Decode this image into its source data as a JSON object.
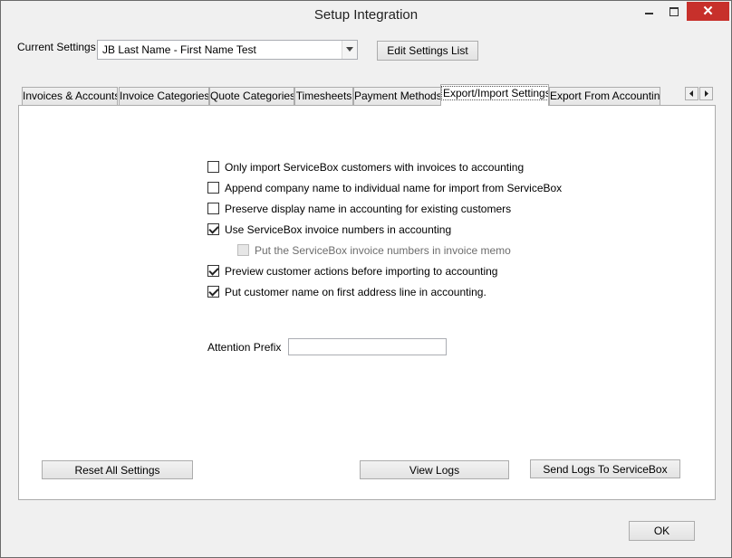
{
  "window": {
    "title": "Setup Integration",
    "close_glyph": "✕"
  },
  "settings": {
    "label": "Current Settings",
    "selected": "JB Last Name - First Name Test",
    "edit_button": "Edit Settings List"
  },
  "tabs": [
    {
      "label": "Invoices & Accounts"
    },
    {
      "label": "Invoice Categories"
    },
    {
      "label": "Quote Categories"
    },
    {
      "label": "Timesheets"
    },
    {
      "label": "Payment Methods"
    },
    {
      "label": "Export/Import Settings"
    },
    {
      "label": "Export From Accounting"
    }
  ],
  "options": [
    {
      "label": "Only import ServiceBox customers with invoices to accounting",
      "checked": false,
      "enabled": true
    },
    {
      "label": "Append company name to individual name for import from ServiceBox",
      "checked": false,
      "enabled": true
    },
    {
      "label": "Preserve display name in accounting for existing customers",
      "checked": false,
      "enabled": true
    },
    {
      "label": "Use ServiceBox invoice numbers in accounting",
      "checked": true,
      "enabled": true
    },
    {
      "label": "Put the ServiceBox invoice numbers in invoice memo",
      "checked": false,
      "enabled": false
    },
    {
      "label": "Preview customer actions before importing to accounting",
      "checked": true,
      "enabled": true
    },
    {
      "label": "Put customer name on first address line in accounting.",
      "checked": true,
      "enabled": true
    }
  ],
  "attention": {
    "label": "Attention Prefix",
    "value": ""
  },
  "buttons": {
    "reset": "Reset All Settings",
    "view_logs": "View Logs",
    "send_logs": "Send Logs To ServiceBox",
    "ok": "OK"
  },
  "icons": {
    "tab_scroll_left": "triangle-left-icon",
    "tab_scroll_right": "triangle-right-icon"
  }
}
